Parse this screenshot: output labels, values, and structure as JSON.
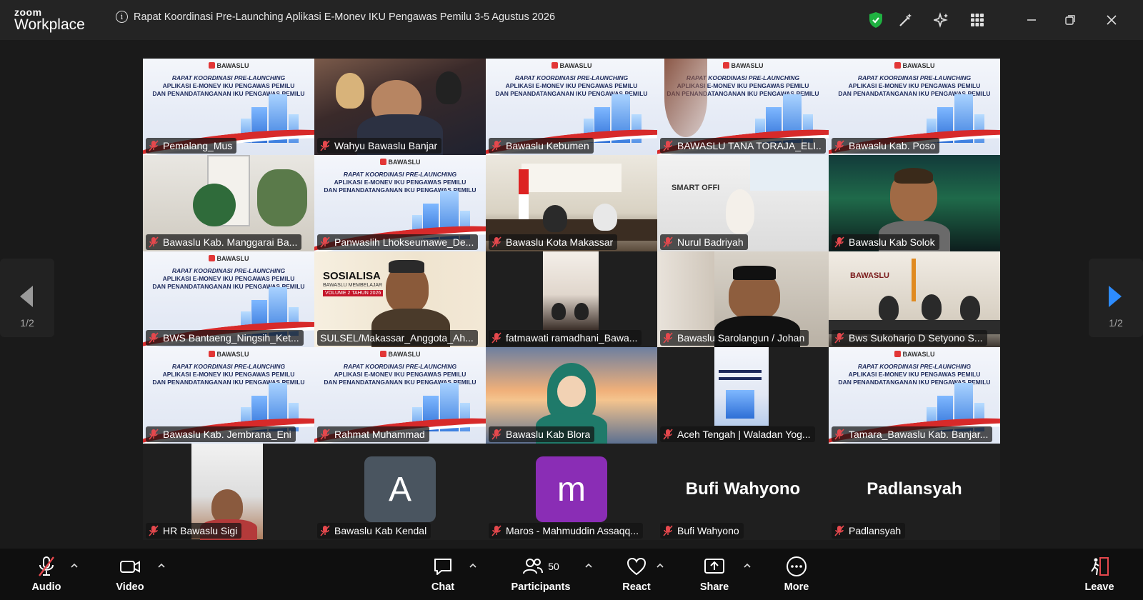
{
  "app": {
    "logo_top": "zoom",
    "logo_bottom": "Workplace"
  },
  "meeting": {
    "title": "Rapat Koordinasi Pre-Launching Aplikasi E-Monev IKU Pengawas Pemilu 3-5 Agustus 2026"
  },
  "slide": {
    "brand": "BAWASLU",
    "line1": "RAPAT KOORDINASI PRE-LAUNCHING",
    "line2": "APLIKASI E-MONEV IKU PENGAWAS PEMILU",
    "line3": "DAN PENANDATANGANAN IKU PENGAWAS PEMILU"
  },
  "participants_tiles": [
    {
      "name": "Pemalang_Mus"
    },
    {
      "name": "Wahyu Bawaslu Banjar"
    },
    {
      "name": "Bawaslu Kebumen"
    },
    {
      "name": "BAWASLU TANA TORAJA_ELI..."
    },
    {
      "name": "Bawaslu Kab. Poso"
    },
    {
      "name": "Bawaslu Kab. Manggarai Ba..."
    },
    {
      "name": "Panwaslih Lhokseumawe_De..."
    },
    {
      "name": "Bawaslu Kota Makassar"
    },
    {
      "name": "Nurul Badriyah"
    },
    {
      "name": "Bawaslu Kab Solok"
    },
    {
      "name": "BWS Bantaeng_Ningsih_Ket..."
    },
    {
      "name": "SULSEL/Makassar_Anggota_Ah..."
    },
    {
      "name": "fatmawati ramadhani_Bawa..."
    },
    {
      "name": "Bawaslu Sarolangun / Johan"
    },
    {
      "name": "Bws Sukoharjo D Setyono S..."
    },
    {
      "name": "Bawaslu Kab. Jembrana_Eni"
    },
    {
      "name": "Rahmat Muhammad"
    },
    {
      "name": "Bawaslu Kab Blora"
    },
    {
      "name": "Aceh Tengah | Waladan Yog..."
    },
    {
      "name": "Tamara_Bawaslu Kab. Banjar..."
    },
    {
      "name": "HR Bawaslu Sigi"
    },
    {
      "name": "Bawaslu Kab Kendal",
      "avatar_letter": "A"
    },
    {
      "name": "Maros - Mahmuddin Assaqq...",
      "avatar_letter": "m"
    },
    {
      "name": "Bufi Wahyono",
      "display_name": "Bufi Wahyono"
    },
    {
      "name": "Padlansyah",
      "display_name": "Padlansyah"
    }
  ],
  "tile_texts": {
    "sosialisasi": "SOSIALISA",
    "sosialisasi_sub": "BAWASLU MEMBELAJAR",
    "sosialisasi_vol": "VOLUME 2 TAHUN 2026",
    "bawaslu_sign": "BAWASLU",
    "smart_office": "SMART OFFI"
  },
  "pager": {
    "left": "1/2",
    "right": "1/2"
  },
  "toolbar": {
    "audio": "Audio",
    "video": "Video",
    "chat": "Chat",
    "participants": "Participants",
    "participants_count": "50",
    "react": "React",
    "share": "Share",
    "more": "More",
    "leave": "Leave"
  },
  "colors": {
    "accent_blue": "#2d8cff",
    "shield_green": "#1fb141",
    "muted_red": "#e5484d",
    "avatar_gray": "#4a5560",
    "avatar_purple": "#8a2db5"
  }
}
